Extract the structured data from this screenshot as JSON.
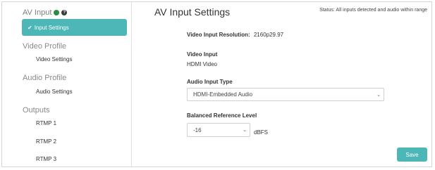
{
  "sidebar": {
    "av_input_title": "AV Input",
    "active_item": {
      "check": "✔",
      "label": "Input Settings"
    },
    "video_profile_title": "Video Profile",
    "video_settings_label": "Video Settings",
    "audio_profile_title": "Audio Profile",
    "audio_settings_label": "Audio Settings",
    "outputs_title": "Outputs",
    "outputs": [
      "RTMP 1",
      "RTMP 2",
      "RTMP 3"
    ]
  },
  "header": {
    "title": "AV Input Settings",
    "status": "Status: All inputs detected and audio within range"
  },
  "form": {
    "resolution_label": "Video Input Resolution:",
    "resolution_value": "2160p29.97",
    "video_input_label": "Video Input",
    "video_input_value": "HDMI Video",
    "audio_input_type_label": "Audio Input Type",
    "audio_input_type_selected": "HDMI-Embedded Audio",
    "balanced_ref_label": "Balanced Reference Level",
    "balanced_ref_selected": "-16",
    "balanced_ref_unit": "dBFS",
    "save_label": "Save"
  },
  "colors": {
    "accent": "#4db6b6",
    "status_green": "#2e8b3f"
  },
  "icons": {
    "status_dot": "green-status-dot-icon",
    "help": "help-icon",
    "check": "check-icon",
    "chevron": "chevron-down-icon"
  }
}
